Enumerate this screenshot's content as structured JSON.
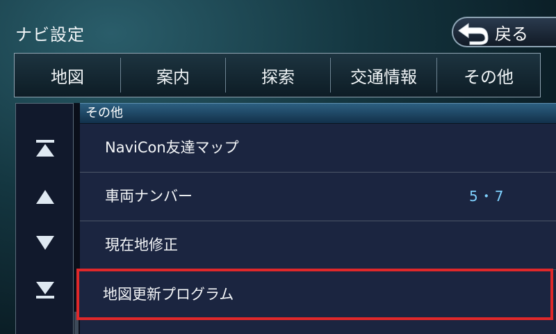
{
  "header": {
    "title": "ナビ設定",
    "back_label": "戻る"
  },
  "tabs": [
    {
      "label": "地図"
    },
    {
      "label": "案内"
    },
    {
      "label": "探索"
    },
    {
      "label": "交通情報"
    },
    {
      "label": "その他"
    }
  ],
  "list": {
    "section_title": "その他",
    "items": [
      {
        "label": "NaviCon友達マップ",
        "value": ""
      },
      {
        "label": "車両ナンバー",
        "value": "5・7"
      },
      {
        "label": "現在地修正",
        "value": ""
      },
      {
        "label": "地図更新プログラム",
        "value": "",
        "highlighted": true
      }
    ]
  },
  "sidebar": {
    "buttons": [
      {
        "icon": "scroll-top-icon"
      },
      {
        "icon": "scroll-up-icon"
      },
      {
        "icon": "scroll-down-icon"
      },
      {
        "icon": "scroll-bottom-icon"
      }
    ]
  },
  "colors": {
    "highlight_border": "#e0282a",
    "value_text": "#7fd2ff",
    "header_bar": "#2c5f80"
  }
}
